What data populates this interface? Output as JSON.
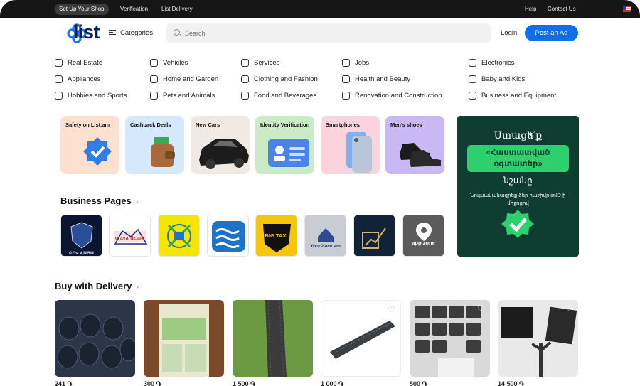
{
  "topbar": {
    "setup_shop": "Set Up Your Shop",
    "verification": "Verification",
    "list_delivery": "List Delivery",
    "help": "Help",
    "contact_us": "Contact Us"
  },
  "header": {
    "logo_text": "list",
    "categories_label": "Categories",
    "search_placeholder": "Search",
    "login": "Login",
    "post_ad": "Post an Ad"
  },
  "categories": [
    {
      "label": "Real Estate",
      "icon": "house-icon"
    },
    {
      "label": "Vehicles",
      "icon": "car-icon"
    },
    {
      "label": "Services",
      "icon": "services-icon"
    },
    {
      "label": "Jobs",
      "icon": "briefcase-icon"
    },
    {
      "label": "Electronics",
      "icon": "monitor-icon"
    },
    {
      "label": "Appliances",
      "icon": "appliance-icon"
    },
    {
      "label": "Home and Garden",
      "icon": "sofa-icon"
    },
    {
      "label": "Clothing and Fashion",
      "icon": "shirt-icon"
    },
    {
      "label": "Health and Beauty",
      "icon": "bottle-icon"
    },
    {
      "label": "Baby and Kids",
      "icon": "stroller-icon"
    },
    {
      "label": "Hobbies and Sports",
      "icon": "ball-icon"
    },
    {
      "label": "Pets and Animals",
      "icon": "paw-icon"
    },
    {
      "label": "Food and Beverages",
      "icon": "cutlery-icon"
    },
    {
      "label": "Renovation and Construction",
      "icon": "construction-icon"
    },
    {
      "label": "Business and Equipment",
      "icon": "equipment-icon"
    }
  ],
  "promos": [
    {
      "title": "Safety on List.am",
      "bg": "#fde0d0"
    },
    {
      "title": "Cashback Deals",
      "bg": "#d6e8fb"
    },
    {
      "title": "New Cars",
      "bg": "#f1e9e3"
    },
    {
      "title": "Identity Verification",
      "bg": "#c9ecc6"
    },
    {
      "title": "Smartphones",
      "bg": "#fcd2df"
    },
    {
      "title": "Men's shoes",
      "bg": "#c9b8f4"
    }
  ],
  "banner": {
    "line1": "Ստացե՛ք",
    "line2": "«Հաստատված օգտատեր»",
    "line3": "նշանը",
    "line4": "Նույնականացրեք ձեր հաշիվը imID-ի միջոցով"
  },
  "business": {
    "title": "Business Pages",
    "items": [
      {
        "name": "ԲՈՎ ՀԱՅԱ",
        "bg": "#0b1530"
      },
      {
        "name": "oravardz.am",
        "bg": "#ffffff"
      },
      {
        "name": "",
        "bg": "#f5e600"
      },
      {
        "name": "",
        "bg": "#ffffff"
      },
      {
        "name": "BIG TAXI",
        "bg": "#f6c60c"
      },
      {
        "name": "YourPlace.am",
        "bg": "#c9ccd3"
      },
      {
        "name": "",
        "bg": "#102339"
      },
      {
        "name": "app zone",
        "bg": "#5b5b5b"
      }
    ]
  },
  "delivery": {
    "title": "Buy with Delivery",
    "products": [
      {
        "price": "241 ֏"
      },
      {
        "price": "300 ֏"
      },
      {
        "price": "1 500 ֏"
      },
      {
        "price": "1 000 ֏"
      },
      {
        "price": "500 ֏"
      },
      {
        "price": "14 500 ֏"
      }
    ]
  },
  "colors": {
    "accent": "#0f6ee8",
    "topbar": "#161616",
    "logo": "#0b2447",
    "banner": "#0f3d32",
    "banner_green": "#2ed06e"
  }
}
